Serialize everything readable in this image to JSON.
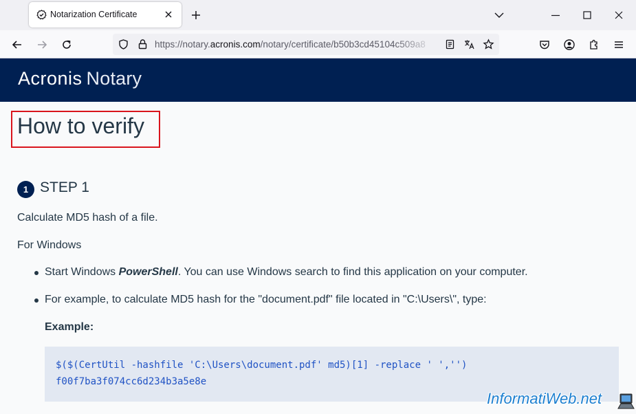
{
  "browser": {
    "tab_title": "Notarization Certificate",
    "url_prefix": "https://notary.",
    "url_domain": "acronis.com",
    "url_path": "/notary/certificate/b50b3cd45104c509a8"
  },
  "site": {
    "brand": "Acronis",
    "product": "Notary",
    "header_color": "#002052"
  },
  "content": {
    "heading": "How to verify",
    "step_number": "1",
    "step_title": "STEP 1",
    "intro": "Calculate MD5 hash of a file.",
    "platform": "For Windows",
    "bullet1_pre": "Start Windows ",
    "bullet1_em": "PowerShell",
    "bullet1_post": ". You can use Windows search to find this application on your computer.",
    "bullet2": "For example, to calculate MD5 hash for the \"document.pdf\" file located in \"C:\\Users\\\", type:",
    "example_label": "Example:",
    "code_line1": "$($(CertUtil -hashfile 'C:\\Users\\document.pdf' md5)[1] -replace ' ','')",
    "code_line2": "f00f7ba3f074cc6d234b3a5e8e"
  },
  "watermark": {
    "text": "InformatiWeb.net"
  }
}
